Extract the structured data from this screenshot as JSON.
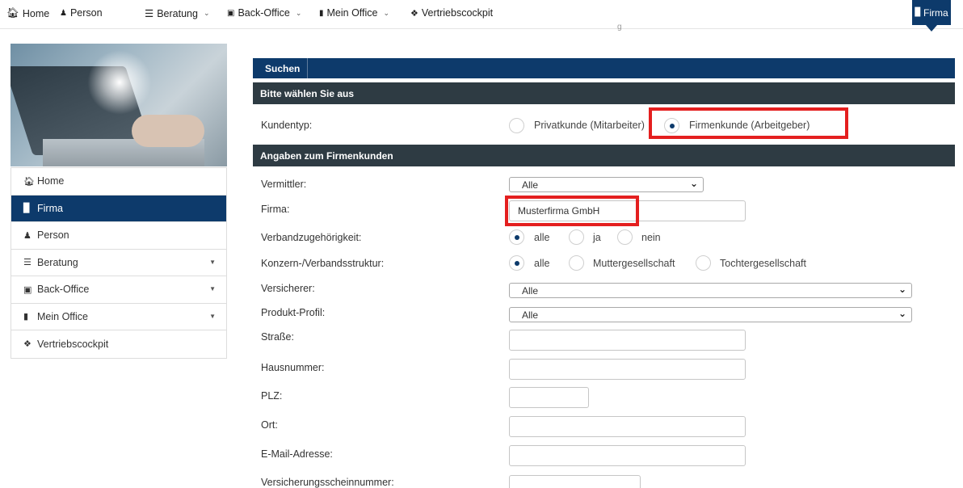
{
  "topnav": {
    "home": "Home",
    "person": "Person",
    "beratung": "Beratung",
    "backoffice": "Back-Office",
    "meinoffice": "Mein Office",
    "vertriebscockpit": "Vertriebscockpit",
    "firma_badge": "Firma",
    "stray_char": "g"
  },
  "sidebar": {
    "items": [
      {
        "label": "Home",
        "icon": "home-icon"
      },
      {
        "label": "Firma",
        "icon": "factory-icon",
        "active": true
      },
      {
        "label": "Person",
        "icon": "person-icon"
      },
      {
        "label": "Beratung",
        "icon": "list-icon",
        "caret": true
      },
      {
        "label": "Back-Office",
        "icon": "briefcase-icon",
        "caret": true
      },
      {
        "label": "Mein Office",
        "icon": "book-icon",
        "caret": true
      },
      {
        "label": "Vertriebscockpit",
        "icon": "info-icon"
      }
    ]
  },
  "main": {
    "tab": "Suchen",
    "section1": "Bitte wählen Sie aus",
    "kundentyp": {
      "label": "Kundentyp:",
      "opt1": "Privatkunde (Mitarbeiter)",
      "opt2": "Firmenkunde (Arbeitgeber)",
      "selected": "Firmenkunde (Arbeitgeber)"
    },
    "section2": "Angaben zum Firmenkunden",
    "vermittler": {
      "label": "Vermittler:",
      "value": "Alle"
    },
    "firma": {
      "label": "Firma:",
      "value": "Musterfirma GmbH"
    },
    "verband": {
      "label": "Verbandzugehörigkeit:",
      "opt1": "alle",
      "opt2": "ja",
      "opt3": "nein",
      "selected": "alle"
    },
    "konzern": {
      "label": "Konzern-/Verbandsstruktur:",
      "opt1": "alle",
      "opt2": "Muttergesellschaft",
      "opt3": "Tochtergesellschaft",
      "selected": "alle"
    },
    "versicherer": {
      "label": "Versicherer:",
      "value": "Alle"
    },
    "produkt": {
      "label": "Produkt-Profil:",
      "value": "Alle"
    },
    "strasse": {
      "label": "Straße:",
      "value": ""
    },
    "hausnummer": {
      "label": "Hausnummer:",
      "value": ""
    },
    "plz": {
      "label": "PLZ:",
      "value": ""
    },
    "ort": {
      "label": "Ort:",
      "value": ""
    },
    "email": {
      "label": "E-Mail-Adresse:",
      "value": ""
    },
    "vsnr": {
      "label": "Versicherungsscheinnummer:",
      "value": ""
    }
  },
  "colors": {
    "nav_blue": "#0d3a6b",
    "section_dark": "#2e3b43",
    "highlight_red": "#e41f1f"
  }
}
